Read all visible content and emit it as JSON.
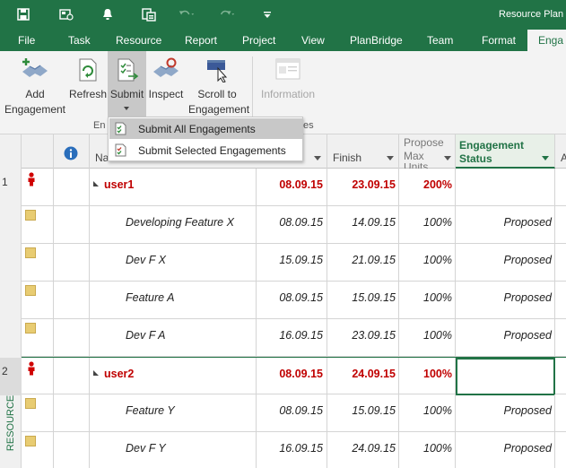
{
  "title_bar": {
    "title": "Resource Plan",
    "icons": [
      "save-icon",
      "connect-icon",
      "notification-icon",
      "clipboard-icon",
      "undo-icon",
      "redo-icon",
      "customize-icon"
    ]
  },
  "tabs": [
    "File",
    "Task",
    "Resource",
    "Report",
    "Project",
    "View",
    "PlanBridge",
    "Team",
    "Format"
  ],
  "active_tab": "Enga",
  "ribbon": {
    "add_engagement": {
      "line1": "Add",
      "line2": "Engagement"
    },
    "refresh": "Refresh",
    "submit": "Submit",
    "inspect": "Inspect",
    "scroll_to": {
      "line1": "Scroll to",
      "line2": "Engagement"
    },
    "information": "Information",
    "group_label_left": "En",
    "group_label_right": "es"
  },
  "dropdown": {
    "items": [
      {
        "label": "Submit All Engagements"
      },
      {
        "label": "Submit Selected Engagements"
      }
    ]
  },
  "side_label": "RESOURCE PLAN",
  "grid": {
    "headers": {
      "name": "Na",
      "finish": "Finish",
      "max_units": {
        "line1": "Propose",
        "line2": "Max",
        "line3": "Units"
      },
      "status": {
        "line1": "Engagement",
        "line2": "Status"
      },
      "extra": "A"
    },
    "rows": [
      {
        "num": "1",
        "type": "resource",
        "name": "user1",
        "start": "08.09.15",
        "finish": "23.09.15",
        "units": "200%",
        "status": ""
      },
      {
        "num": "",
        "type": "engagement",
        "name": "Developing Feature X",
        "start": "08.09.15",
        "finish": "14.09.15",
        "units": "100%",
        "status": "Proposed"
      },
      {
        "num": "",
        "type": "engagement",
        "name": "Dev F X",
        "start": "15.09.15",
        "finish": "21.09.15",
        "units": "100%",
        "status": "Proposed"
      },
      {
        "num": "",
        "type": "engagement",
        "name": "Feature A",
        "start": "08.09.15",
        "finish": "15.09.15",
        "units": "100%",
        "status": "Proposed"
      },
      {
        "num": "",
        "type": "engagement",
        "name": "Dev F A",
        "start": "16.09.15",
        "finish": "23.09.15",
        "units": "100%",
        "status": "Proposed"
      },
      {
        "num": "2",
        "type": "resource",
        "name": "user2",
        "start": "08.09.15",
        "finish": "24.09.15",
        "units": "100%",
        "status": ""
      },
      {
        "num": "",
        "type": "engagement",
        "name": "Feature Y",
        "start": "08.09.15",
        "finish": "15.09.15",
        "units": "100%",
        "status": "Proposed"
      },
      {
        "num": "",
        "type": "engagement",
        "name": "Dev F Y",
        "start": "16.09.15",
        "finish": "24.09.15",
        "units": "100%",
        "status": "Proposed"
      }
    ]
  },
  "colors": {
    "accent": "#217346",
    "overallocated": "#c00000"
  }
}
